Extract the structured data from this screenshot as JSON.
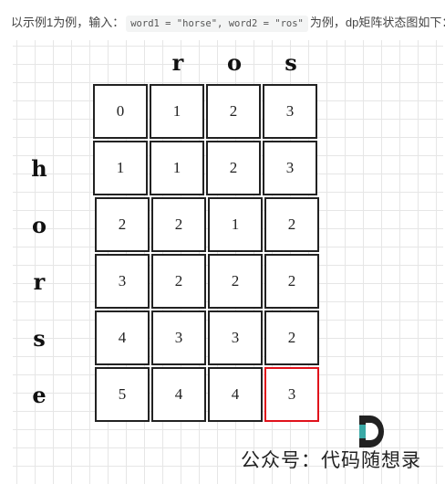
{
  "intro": {
    "before": "以示例1为例，输入：",
    "code": "word1 = \"horse\", word2 = \"ros\"",
    "after": "为例，dp矩阵状态图如下："
  },
  "columns": [
    "r",
    "o",
    "s"
  ],
  "rows": [
    "h",
    "o",
    "r",
    "s",
    "e"
  ],
  "matrix": [
    [
      0,
      1,
      2,
      3
    ],
    [
      1,
      1,
      2,
      3
    ],
    [
      2,
      2,
      1,
      2
    ],
    [
      3,
      2,
      2,
      2
    ],
    [
      4,
      3,
      3,
      2
    ],
    [
      5,
      4,
      4,
      3
    ]
  ],
  "highlight": {
    "row": 5,
    "col": 3,
    "color": "#e0121b"
  },
  "watermark": "公众号：代码随想录",
  "logo_colors": {
    "dark": "#222222",
    "teal": "#3aa9a6"
  }
}
